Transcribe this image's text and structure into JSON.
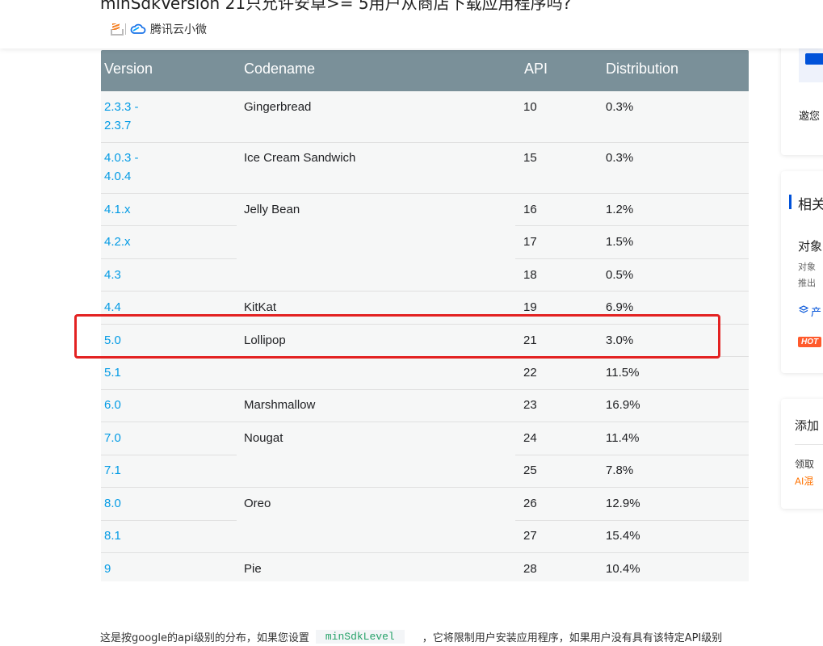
{
  "header": {
    "title": "minSdkVersion 21只允许安卓>= 5用户从商店下载应用程序吗?",
    "source": "腾讯云小微"
  },
  "table": {
    "headers": [
      "Version",
      "Codename",
      "API",
      "Distribution"
    ],
    "versions": [
      "2.3.3 - 2.3.7",
      "4.0.3 - 4.0.4",
      "4.1.x",
      "4.2.x",
      "4.3",
      "4.4",
      "5.0",
      "5.1",
      "6.0",
      "7.0",
      "7.1",
      "8.0",
      "8.1",
      "9"
    ],
    "version_lines": [
      [
        "2.3.3 -",
        "2.3.7"
      ],
      [
        "4.0.3 -",
        "4.0.4"
      ]
    ],
    "codenames": [
      "Gingerbread",
      "Ice Cream Sandwich",
      "Jelly Bean",
      "KitKat",
      "Lollipop",
      "Marshmallow",
      "Nougat",
      "Oreo",
      "Pie"
    ],
    "apis": [
      "10",
      "15",
      "16",
      "17",
      "18",
      "19",
      "21",
      "22",
      "23",
      "24",
      "25",
      "26",
      "27",
      "28"
    ],
    "distributions": [
      "0.3%",
      "0.3%",
      "1.2%",
      "1.5%",
      "0.5%",
      "6.9%",
      "3.0%",
      "11.5%",
      "16.9%",
      "11.4%",
      "7.8%",
      "12.9%",
      "15.4%",
      "10.4%"
    ],
    "highlighted_version": "5.0"
  },
  "description": {
    "before": "这是按google的api级别的分布，如果您设置",
    "code": "minSdkLevel",
    "after": "，它将限制用户安装应用程序，如果用户没有具有该特定API级别"
  },
  "sidebar": {
    "invite_text": "邀您",
    "related_heading": "相关",
    "related_title": "对象",
    "related_desc_1": "对象",
    "related_desc_2": "推出",
    "product_link": "产",
    "hot_badge": "HOT",
    "add_title": "添加",
    "claim_text": "领取",
    "ai_text": "AI混"
  },
  "colors": {
    "header_bg": "#7a9099",
    "link": "#039be5",
    "highlight_border": "#e32222",
    "hot_badge": "#ff5a2c",
    "accent_blue": "#0052d9",
    "ai_orange": "#ff7200"
  }
}
